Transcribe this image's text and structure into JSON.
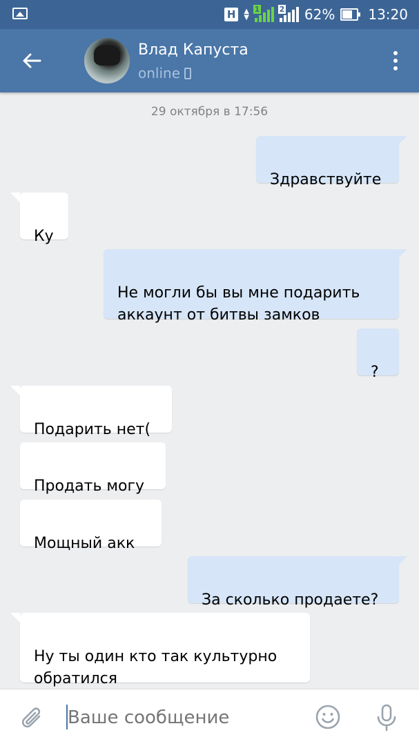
{
  "status_bar": {
    "network_type": "H",
    "sim1_label": "1",
    "sim2_label": "2",
    "battery": "62%",
    "time": "13:20",
    "icons": [
      "gallery-icon",
      "signal-icon",
      "battery-icon"
    ]
  },
  "header": {
    "contact_name": "Влад Капуста",
    "status": "online",
    "accent": "#4a76a8"
  },
  "chat": {
    "date_label": "29 октября в 17:56",
    "messages": [
      {
        "dir": "out",
        "text": "Здравствуйте"
      },
      {
        "dir": "in",
        "text": "Ку"
      },
      {
        "dir": "out",
        "text": "Не могли бы вы мне подарить\nаккаунт от битвы замков"
      },
      {
        "dir": "out",
        "text": "?"
      },
      {
        "dir": "in",
        "text": "Подарить нет("
      },
      {
        "dir": "in",
        "text": "Продать могу"
      },
      {
        "dir": "in",
        "text": "Мощный акк"
      },
      {
        "dir": "out",
        "text": "За сколько продаете?"
      },
      {
        "dir": "in",
        "text": "Ну ты один кто так культурно\nобратился"
      }
    ],
    "colors": {
      "outgoing_bubble": "#d6e5f7",
      "incoming_bubble": "#ffffff",
      "background": "#edeef0"
    }
  },
  "composer": {
    "placeholder": "Ваше сообщение"
  }
}
